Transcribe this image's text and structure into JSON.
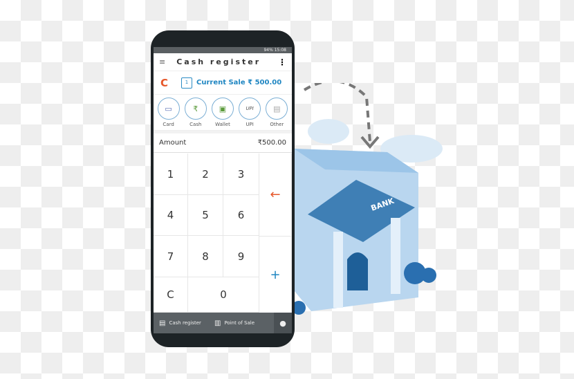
{
  "status": {
    "battery": "94%",
    "time": "15:08"
  },
  "header": {
    "title": "Cash register"
  },
  "sale": {
    "logo": "C",
    "count": "1",
    "label": "Current Sale ₹ 500.00"
  },
  "payment_methods": [
    {
      "label": "Card",
      "icon": "card-icon"
    },
    {
      "label": "Cash",
      "icon": "cash-icon"
    },
    {
      "label": "Wallet",
      "icon": "wallet-icon"
    },
    {
      "label": "UPI",
      "icon": "upi-icon"
    },
    {
      "label": "Other",
      "icon": "document-icon"
    }
  ],
  "amount": {
    "label": "Amount",
    "value": "₹500.00"
  },
  "keypad": [
    "1",
    "2",
    "3",
    "4",
    "5",
    "6",
    "7",
    "8",
    "9",
    "C",
    "0"
  ],
  "keypad_side": {
    "backspace": "←",
    "add": "+"
  },
  "nav": {
    "cash_register": "Cash register",
    "pos": "Point of Sale"
  },
  "illustration": {
    "bank_sign": "BANK"
  },
  "colors": {
    "accent": "#1f86c2",
    "orange": "#e6572a",
    "nav": "#5b6165"
  }
}
